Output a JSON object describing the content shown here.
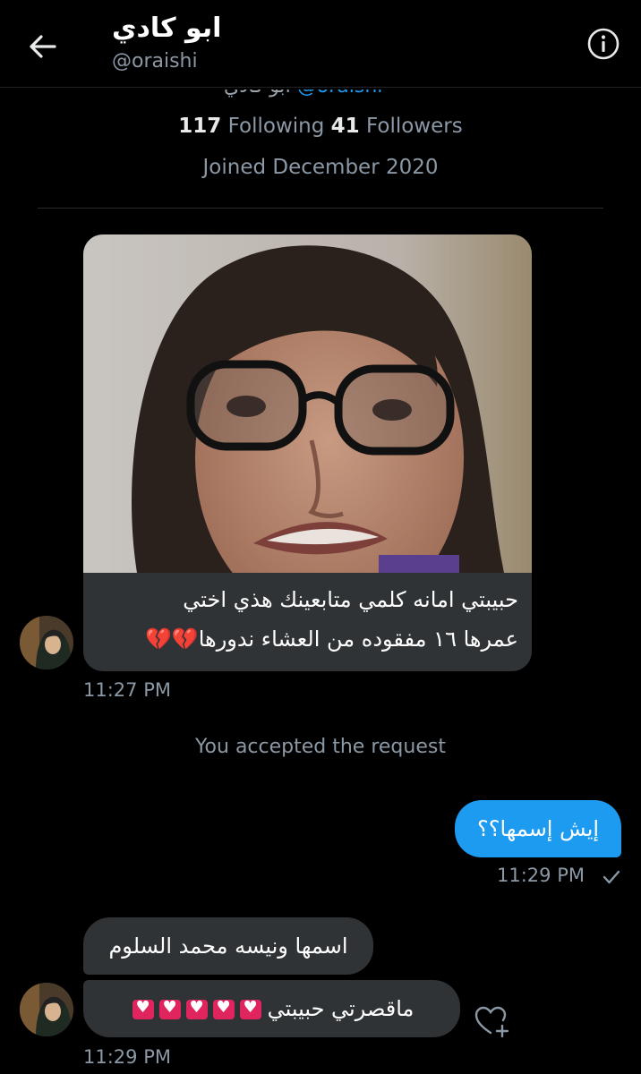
{
  "header": {
    "title": "ابو كادي",
    "handle": "@oraishi"
  },
  "peek": {
    "name": "ابو كادي",
    "handle": "@oraishi"
  },
  "profile": {
    "following_count": "117",
    "following_label": "Following",
    "followers_count": "41",
    "followers_label": "Followers",
    "joined": "Joined December 2020"
  },
  "messages": {
    "first": {
      "line1": "حبيبتي امانه كلمي متابعينك هذي اختي",
      "line2": "عمرها ١٦ مفقوده من العشاء ندورها",
      "emoji": "💔💔",
      "time": "11:27 PM"
    },
    "notice": "You accepted the request",
    "outgoing": {
      "text": "إيش إسمها؟؟",
      "time": "11:29 PM"
    },
    "second": {
      "text": "اسمها ونيسه محمد السلوم"
    },
    "third": {
      "text": "ماقصرتي حبيبتي",
      "hearts": 5,
      "time": "11:29 PM"
    }
  },
  "colors": {
    "accent": "#1d9bf0",
    "bubble_incoming": "#2f3336",
    "heart": "#e0245e"
  },
  "icons": {
    "back": "arrow-left-icon",
    "info": "info-icon",
    "react": "heart-plus-icon",
    "sent": "checkmark-icon"
  }
}
